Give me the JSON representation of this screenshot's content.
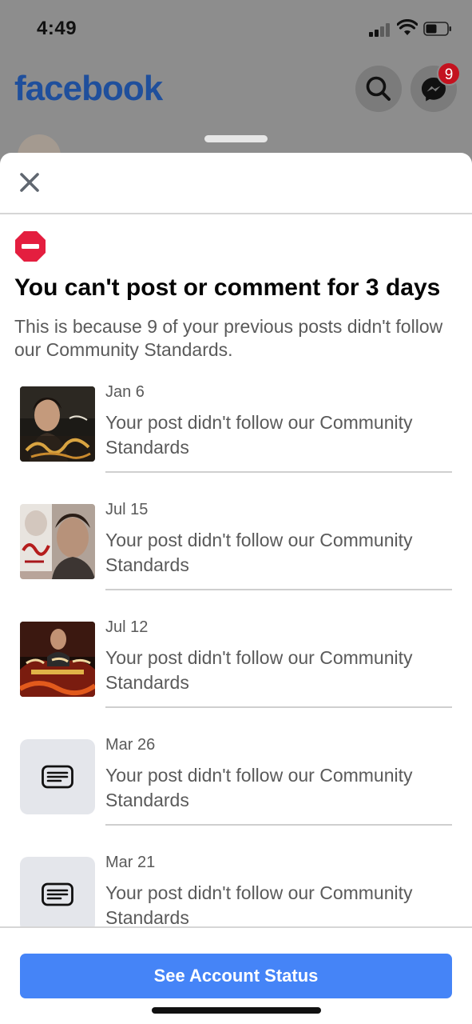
{
  "status_bar": {
    "time": "4:49"
  },
  "header": {
    "logo": "facebook",
    "search_icon": "search-icon",
    "messenger_icon": "messenger-icon",
    "messenger_badge": "9"
  },
  "sheet": {
    "close_icon": "close-icon",
    "alert_icon": "no-entry-icon",
    "title": "You can't post or comment for 3 days",
    "subtitle": "This is because 9 of your previous posts didn't follow our Community Standards.",
    "items": [
      {
        "date": "Jan 6",
        "message": "Your post didn't follow our Community Standards",
        "thumb": "photo"
      },
      {
        "date": "Jul 15",
        "message": "Your post didn't follow our Community Standards",
        "thumb": "photo"
      },
      {
        "date": "Jul 12",
        "message": "Your post didn't follow our Community Standards",
        "thumb": "photo"
      },
      {
        "date": "Mar 26",
        "message": "Your post didn't follow our Community Standards",
        "thumb": "text-post-icon"
      },
      {
        "date": "Mar 21",
        "message": "Your post didn't follow our Community Standards",
        "thumb": "text-post-icon"
      }
    ],
    "cta_label": "See Account Status"
  },
  "colors": {
    "brand": "#1f4f9c",
    "cta": "#4584f7",
    "alert": "#e41e3f",
    "badge": "#c4121f"
  }
}
